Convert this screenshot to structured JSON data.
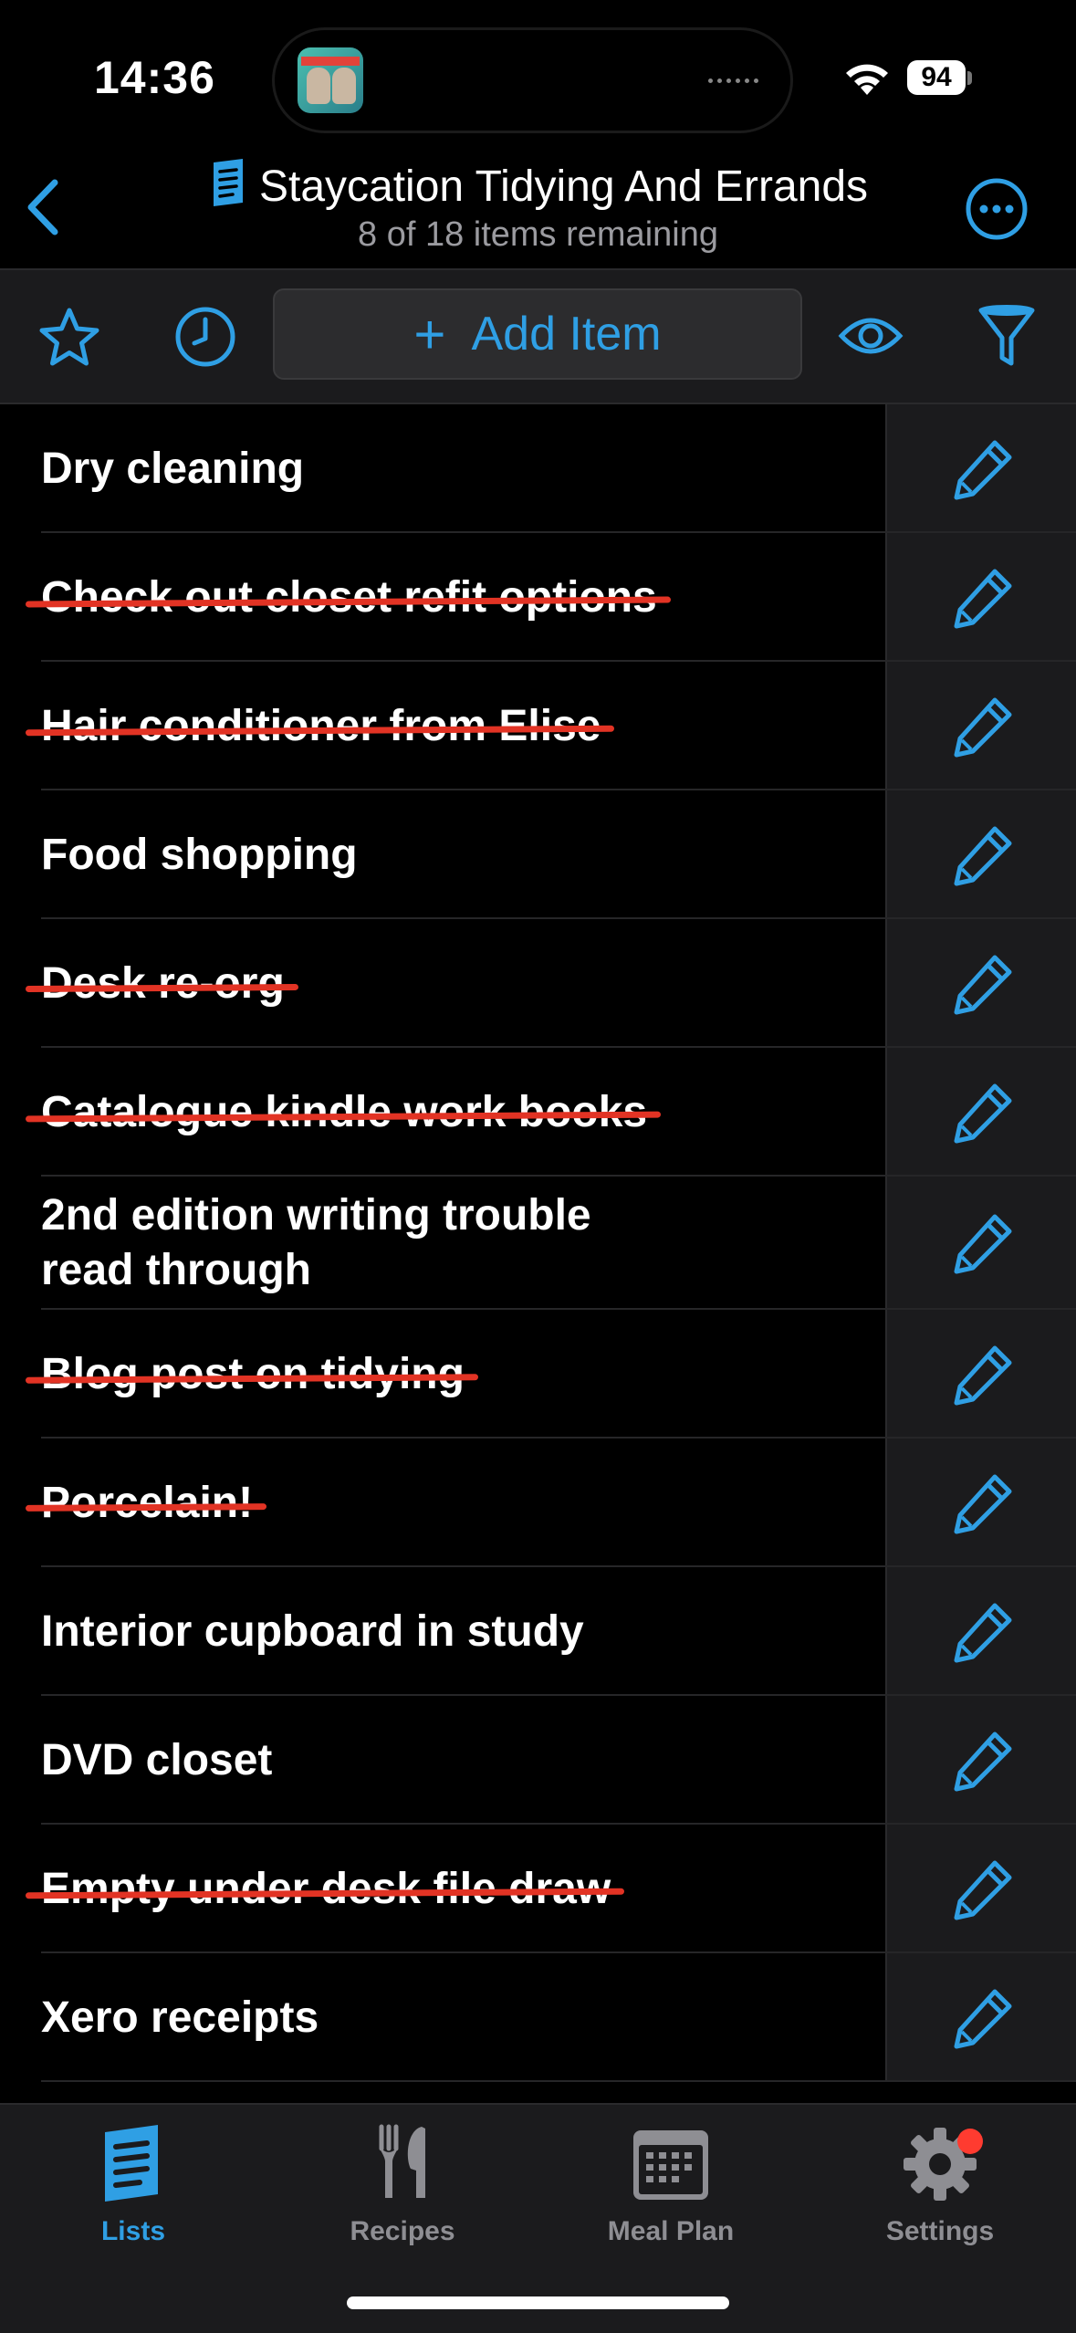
{
  "status_bar": {
    "time": "14:36",
    "battery": "94"
  },
  "header": {
    "title": "Staycation Tidying And Errands",
    "subtitle": "8 of 18 items remaining",
    "back_icon": "chevron-left-icon",
    "more_icon": "ellipsis-circle-icon"
  },
  "toolbar": {
    "add_label": "Add Item",
    "add_symbol": "+",
    "icons": [
      "star-icon",
      "clock-icon",
      "eye-icon",
      "filter-icon"
    ]
  },
  "items": [
    {
      "text": "Dry cleaning",
      "done": false
    },
    {
      "text": "Check out closet refit options",
      "done": true
    },
    {
      "text": "Hair conditioner from Elise",
      "done": true
    },
    {
      "text": "Food shopping",
      "done": false
    },
    {
      "text": "Desk re-org",
      "done": true
    },
    {
      "text": "Catalogue kindle work books",
      "done": true
    },
    {
      "text": "2nd edition writing trouble read through",
      "done": false
    },
    {
      "text": "Blog post on tidying",
      "done": true
    },
    {
      "text": "Porcelain!",
      "done": true
    },
    {
      "text": "Interior cupboard in study",
      "done": false
    },
    {
      "text": "DVD closet",
      "done": false
    },
    {
      "text": "Empty under desk file draw",
      "done": true
    },
    {
      "text": "Xero receipts",
      "done": false
    }
  ],
  "tabs": [
    {
      "label": "Lists",
      "icon": "list-icon",
      "active": true
    },
    {
      "label": "Recipes",
      "icon": "fork-knife-icon",
      "active": false
    },
    {
      "label": "Meal Plan",
      "icon": "calendar-icon",
      "active": false
    },
    {
      "label": "Settings",
      "icon": "gear-icon",
      "active": false,
      "badge": true
    }
  ],
  "colors": {
    "accent": "#2f9fe4",
    "strike": "#e23324",
    "background": "#000000",
    "panel": "#1b1b1d"
  }
}
